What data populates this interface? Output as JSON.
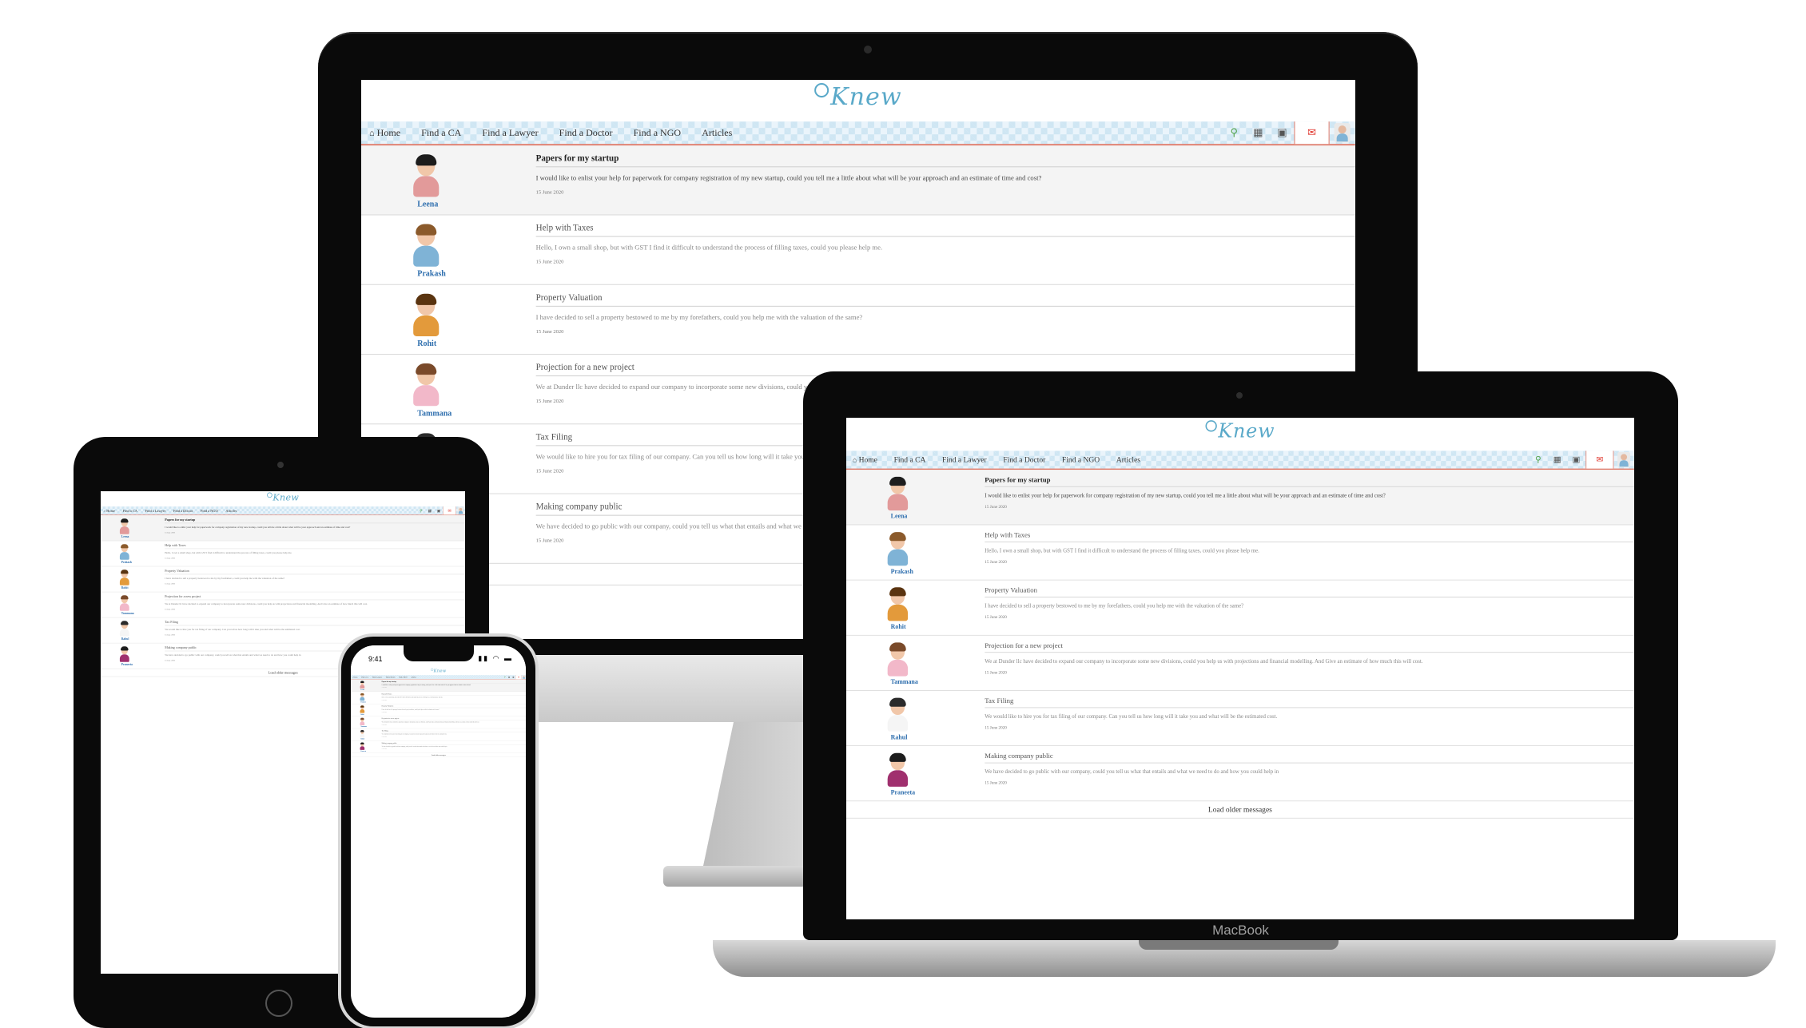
{
  "app": {
    "logo_text": "Knew",
    "nav": {
      "items": [
        {
          "label": "Home",
          "icon": "home-icon"
        },
        {
          "label": "Find a CA"
        },
        {
          "label": "Find a Lawyer"
        },
        {
          "label": "Find a Doctor"
        },
        {
          "label": "Find a NGO"
        },
        {
          "label": "Articles"
        }
      ],
      "right_icons": [
        "search-icon",
        "calendar-icon",
        "calendar-check-icon",
        "mail-icon",
        "profile-avatar"
      ]
    },
    "messages": [
      {
        "name": "Leena",
        "subject": "Papers for my startup",
        "text": "I would like to enlist your help for paperwork for company registration of my new startup, could you tell me a little about what will be your approach and an estimate of time and cost?",
        "date": "15 June 2020",
        "unread": true,
        "hair": "#1d1d1d",
        "shirt": "#e29a9a"
      },
      {
        "name": "Prakash",
        "subject": "Help with Taxes",
        "text": "Hello, I own a small shop, but with GST I find it difficult to understand the process of filling taxes, could you please help me.",
        "date": "15 June 2020",
        "unread": false,
        "hair": "#8b5a2b",
        "shirt": "#7fb3d6"
      },
      {
        "name": "Rohit",
        "subject": "Property Valuation",
        "text": "I have decided to sell a property bestowed to me by my forefathers, could you help me with the valuation of the same?",
        "date": "15 June 2020",
        "unread": false,
        "hair": "#5a3410",
        "shirt": "#e39a3b"
      },
      {
        "name": "Tammana",
        "subject": "Projection for a new project",
        "text": "We at Dunder llc have decided to expand our company to incorporate some new divisions, could you help us with projections and financial modelling. And Give an estimate of how much this will cost.",
        "date": "15 June 2020",
        "unread": false,
        "hair": "#7a4a2a",
        "shirt": "#f2b8c9"
      },
      {
        "name": "Rahul",
        "subject": "Tax Filing",
        "text": "We would like to hire you for tax filing of our company. Can you tell us how long will it take you and what will be the estimated cost.",
        "date": "15 June 2020",
        "unread": false,
        "hair": "#2b2b2b",
        "shirt": "#f5f5f5"
      },
      {
        "name": "Praneeta",
        "subject": "Making company public",
        "text": "We have decided to go public with our company, could you tell us what that entails and what we need to do and how you could help in",
        "date": "15 June 2020",
        "unread": false,
        "hair": "#1d1d1d",
        "shirt": "#a0306e"
      }
    ],
    "load_older": "Load older messages"
  },
  "devices": {
    "macbook_label": "MacBook",
    "iphone_time": "9:41"
  }
}
